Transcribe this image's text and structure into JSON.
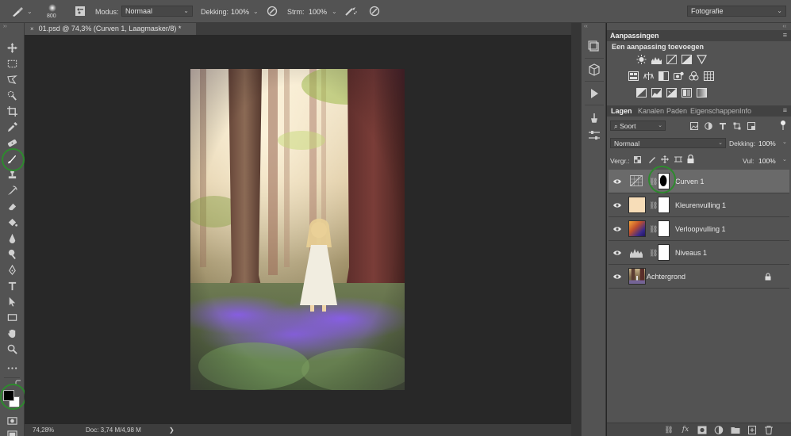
{
  "options_bar": {
    "brush_size": "800",
    "mode_label": "Modus:",
    "mode_value": "Normaal",
    "opacity_label": "Dekking:",
    "opacity_value": "100%",
    "flow_label": "Strm:",
    "flow_value": "100%",
    "workspace_value": "Fotografie"
  },
  "document": {
    "tab_title": "01.psd @ 74,3% (Curven 1, Laagmasker/8) *",
    "close_glyph": "×",
    "zoom": "74,28%",
    "doc_size": "Doc: 3,74 M/4,98 M",
    "status_arrow": "❯"
  },
  "adjustments": {
    "title": "Aanpassingen",
    "subtitle": "Een aanpassing toevoegen"
  },
  "layers_panel": {
    "tabs": [
      "Lagen",
      "Kanalen",
      "Paden",
      "Eigenschappen",
      "Info"
    ],
    "filter_label": "Soort",
    "blend_mode": "Normaal",
    "opacity_label": "Dekking:",
    "opacity_value": "100%",
    "lock_label": "Vergr.:",
    "fill_label": "Vul:",
    "fill_value": "100%",
    "layers": [
      {
        "name": "Curven 1",
        "kind": "curves",
        "selected": true
      },
      {
        "name": "Kleurenvulling 1",
        "kind": "solid_fill",
        "thumb_color": "#f7ddb8"
      },
      {
        "name": "Verloopvulling 1",
        "kind": "gradient_fill"
      },
      {
        "name": "Niveaus 1",
        "kind": "levels"
      },
      {
        "name": "Achtergrond",
        "kind": "background",
        "locked": true
      }
    ]
  },
  "colors": {
    "foreground": "#000000",
    "background": "#ffffff",
    "highlight_ring": "#2e8a2e"
  }
}
